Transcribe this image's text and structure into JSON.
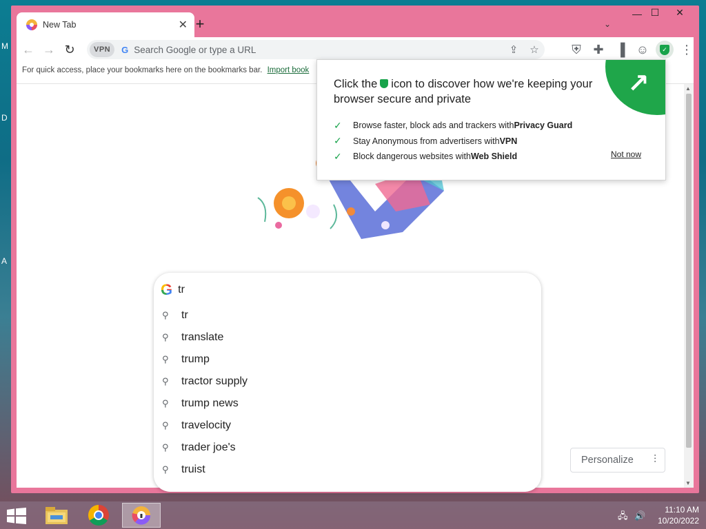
{
  "desktop": {
    "letters": [
      "M",
      "D",
      "A"
    ]
  },
  "tab": {
    "title": "New Tab",
    "close": "✕"
  },
  "window_controls": {
    "minimize": "—",
    "maximize": "☐",
    "close": "✕"
  },
  "toolbar": {
    "vpn_label": "VPN",
    "omnibox_placeholder": "Search Google or type a URL"
  },
  "bookmarks_bar": {
    "text": "For quick access, place your bookmarks here on the bookmarks bar.",
    "link": "Import book"
  },
  "popup": {
    "heading_before": "Click the",
    "heading_after": "icon to discover how we're keeping your browser secure and private",
    "items": [
      {
        "text": "Browse faster, block ads and trackers with ",
        "bold": "Privacy Guard"
      },
      {
        "text": "Stay Anonymous from advertisers with ",
        "bold": "VPN"
      },
      {
        "text": "Block dangerous websites with ",
        "bold": "Web Shield"
      }
    ],
    "not_now": "Not now"
  },
  "search": {
    "query": "tr",
    "suggestions": [
      "tr",
      "translate",
      "trump",
      "tractor supply",
      "trump news",
      "travelocity",
      "trader joe's",
      "truist"
    ]
  },
  "personalize": {
    "label": "Personalize"
  },
  "taskbar": {
    "time": "11:10 AM",
    "date": "10/20/2022"
  },
  "colors": {
    "accent_green": "#17a34a",
    "window_frame": "#e9769b"
  },
  "icons": [
    "back-icon",
    "forward-icon",
    "reload-icon",
    "share-icon",
    "star-icon",
    "privacy-icon",
    "extensions-icon",
    "sidepanel-icon",
    "profile-icon",
    "shield-icon",
    "menu-icon"
  ]
}
